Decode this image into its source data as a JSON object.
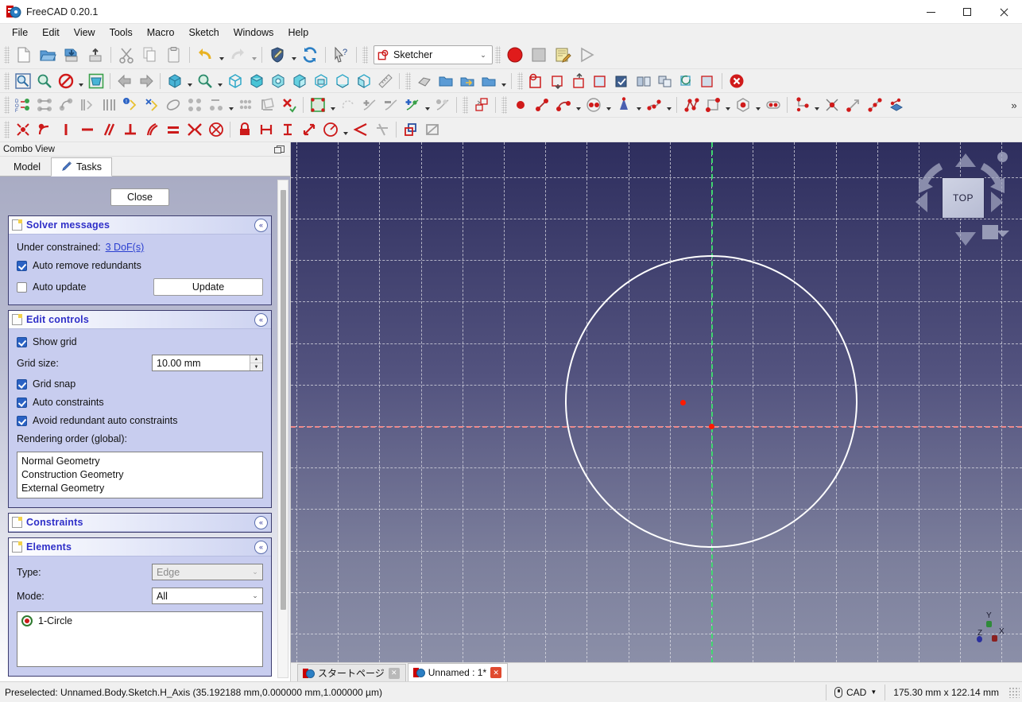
{
  "window": {
    "title": "FreeCAD 0.20.1",
    "logo_icon": "freecad-logo-icon",
    "minimize_label": "─",
    "maximize_label": "□",
    "close_label": "✕"
  },
  "menubar": {
    "items": [
      {
        "label": "File"
      },
      {
        "label": "Edit"
      },
      {
        "label": "View"
      },
      {
        "label": "Tools"
      },
      {
        "label": "Macro"
      },
      {
        "label": "Sketch"
      },
      {
        "label": "Windows"
      },
      {
        "label": "Help"
      }
    ]
  },
  "toolbars": {
    "file": [
      {
        "name": "new-document-button",
        "icon": "new-document-icon"
      },
      {
        "name": "open-document-button",
        "icon": "open-folder-icon"
      },
      {
        "name": "save-document-button",
        "icon": "save-icon"
      },
      {
        "name": "save-as-button",
        "icon": "save-as-icon"
      },
      {
        "name": "cut-button",
        "icon": "scissors-icon"
      },
      {
        "name": "copy-button",
        "icon": "copy-icon"
      },
      {
        "name": "paste-button",
        "icon": "clipboard-paste-icon"
      },
      {
        "name": "undo-button",
        "icon": "undo-arrow-icon"
      },
      {
        "name": "redo-button",
        "icon": "redo-arrow-icon"
      },
      {
        "name": "refresh-style-button",
        "icon": "shield-pencil-icon"
      },
      {
        "name": "refresh-button",
        "icon": "refresh-icon"
      },
      {
        "name": "whats-this-button",
        "icon": "cursor-question-icon"
      }
    ],
    "workbench": {
      "name": "workbench-selector",
      "value": "Sketcher",
      "icon": "sketcher-workbench-icon",
      "caret": "⌄"
    },
    "macro": [
      {
        "name": "macro-record-button",
        "icon": "record-circle-icon"
      },
      {
        "name": "macro-stop-button",
        "icon": "stop-square-icon"
      },
      {
        "name": "macro-edit-button",
        "icon": "notepad-pencil-icon"
      },
      {
        "name": "macro-execute-button",
        "icon": "play-triangle-icon"
      }
    ],
    "view": [
      {
        "name": "fit-all-button",
        "icon": "fit-all-magnifier-icon"
      },
      {
        "name": "fit-selection-button",
        "icon": "fit-selection-magnifier-icon"
      },
      {
        "name": "draw-style-button",
        "icon": "no-entry-draw-style-icon"
      },
      {
        "name": "box-selection-button",
        "icon": "box-selection-icon"
      },
      {
        "name": "nav-back-button",
        "icon": "arrow-left-icon"
      },
      {
        "name": "nav-forward-button",
        "icon": "arrow-right-icon"
      },
      {
        "name": "std-views-button",
        "icon": "cube-views-icon"
      },
      {
        "name": "zoom-button",
        "icon": "zoom-magnifier-icon"
      },
      {
        "name": "isometric-view-button",
        "icon": "isometric-cube-icon"
      },
      {
        "name": "front-view-button",
        "icon": "front-view-cube-icon"
      },
      {
        "name": "top-view-button",
        "icon": "top-view-cube-icon"
      },
      {
        "name": "right-view-button",
        "icon": "right-view-cube-icon"
      },
      {
        "name": "rear-view-button",
        "icon": "rear-view-cube-icon"
      },
      {
        "name": "bottom-view-button",
        "icon": "bottom-view-cube-icon"
      },
      {
        "name": "left-view-button",
        "icon": "left-view-cube-icon"
      },
      {
        "name": "measure-button",
        "icon": "ruler-icon"
      },
      {
        "name": "part-boolean-button",
        "icon": "part-shape-icon"
      },
      {
        "name": "create-group-button",
        "icon": "folder-icon"
      },
      {
        "name": "link-object-button",
        "icon": "link-arrow-icon"
      },
      {
        "name": "link-actions-button",
        "icon": "link-folder-icon"
      },
      {
        "name": "create-sketch-button",
        "icon": "create-sketch-icon"
      },
      {
        "name": "attach-sketch-button",
        "icon": "attach-sketch-icon"
      },
      {
        "name": "detach-sketch-button",
        "icon": "detach-sketch-icon"
      },
      {
        "name": "view-section-button",
        "icon": "view-section-icon"
      },
      {
        "name": "validate-sketch-button",
        "icon": "validate-sketch-icon"
      },
      {
        "name": "mirror-sketch-button",
        "icon": "mirror-sketch-icon"
      },
      {
        "name": "merge-sketch-button",
        "icon": "merge-sketch-icon"
      },
      {
        "name": "reorient-sketch-button",
        "icon": "reorient-sketch-icon"
      },
      {
        "name": "map-sketch-button",
        "icon": "map-sketch-icon"
      },
      {
        "name": "sketch-grid-button",
        "icon": "sketch-grid-icon"
      },
      {
        "name": "leave-sketch-button",
        "icon": "leave-sketch-red-x-icon"
      }
    ],
    "sketcher_visual": [
      {
        "name": "show-dof-button",
        "icon": "dof-counter-icon"
      },
      {
        "name": "select-horiz-edges-button",
        "icon": "select-horizontal-edges-icon"
      },
      {
        "name": "select-vert-edges-button",
        "icon": "select-vertical-edges-icon"
      },
      {
        "name": "select-constraints-button",
        "icon": "select-associated-constraints-icon"
      },
      {
        "name": "select-geometry-button",
        "icon": "select-associated-geometry-icon"
      },
      {
        "name": "select-redundant-button",
        "icon": "select-redundant-constraints-icon"
      },
      {
        "name": "select-conflicting-button",
        "icon": "select-conflicting-constraints-icon"
      },
      {
        "name": "select-elements-circle-button",
        "icon": "select-elements-ellipse-icon"
      },
      {
        "name": "restore-internal-geometry-button",
        "icon": "restore-internal-geometry-icon"
      },
      {
        "name": "symmetry-button",
        "icon": "symmetry-icon"
      },
      {
        "name": "clone-button",
        "icon": "clone-points-icon"
      },
      {
        "name": "rectangular-array-button",
        "icon": "rectangular-array-icon"
      },
      {
        "name": "remove-axes-alignment-button",
        "icon": "remove-axes-alignment-icon"
      },
      {
        "name": "delete-all-constraints-button",
        "icon": "delete-all-constraints-icon"
      },
      {
        "name": "visual-sketch-button",
        "icon": "visual-sketch-green-icon"
      },
      {
        "name": "switch-virtual-space-button",
        "icon": "switch-virtual-space-icon"
      },
      {
        "name": "join-curves-button",
        "icon": "join-curves-icon"
      },
      {
        "name": "trim-edge-button",
        "icon": "trim-edge-icon"
      },
      {
        "name": "extend-edge-button",
        "icon": "extend-edge-icon"
      },
      {
        "name": "split-edge-button",
        "icon": "split-edge-icon"
      },
      {
        "name": "external-geometry-button",
        "icon": "external-geometry-icon"
      },
      {
        "name": "carbon-copy-button",
        "icon": "carbon-copy-icon"
      },
      {
        "name": "create-point-button",
        "icon": "point-icon"
      },
      {
        "name": "create-line-button",
        "icon": "line-icon"
      },
      {
        "name": "create-arc-button",
        "icon": "arc-icon"
      },
      {
        "name": "create-circle-button",
        "icon": "circle-icon"
      },
      {
        "name": "create-conic-button",
        "icon": "conic-icon"
      },
      {
        "name": "create-bspline-button",
        "icon": "bspline-icon"
      },
      {
        "name": "create-polyline-button",
        "icon": "polyline-icon"
      },
      {
        "name": "create-rectangle-button",
        "icon": "rectangle-icon"
      },
      {
        "name": "create-polygon-button",
        "icon": "hexagon-icon"
      },
      {
        "name": "create-slot-button",
        "icon": "slot-icon"
      },
      {
        "name": "create-fillet-button",
        "icon": "fillet-icon"
      },
      {
        "name": "trim-button",
        "icon": "trim-scissor-icon"
      },
      {
        "name": "extend-button",
        "icon": "extend-arrow-icon"
      },
      {
        "name": "split-button",
        "icon": "split-icon"
      },
      {
        "name": "toggle-construction-button",
        "icon": "toggle-construction-geometry-icon"
      }
    ],
    "constraints": [
      {
        "name": "constrain-coincident-button",
        "icon": "constraint-coincident-icon"
      },
      {
        "name": "constrain-point-on-object-button",
        "icon": "constraint-point-on-object-icon"
      },
      {
        "name": "constrain-vertical-button",
        "icon": "constraint-vertical-icon"
      },
      {
        "name": "constrain-horizontal-button",
        "icon": "constraint-horizontal-icon"
      },
      {
        "name": "constrain-parallel-button",
        "icon": "constraint-parallel-icon"
      },
      {
        "name": "constrain-perpendicular-button",
        "icon": "constraint-perpendicular-icon"
      },
      {
        "name": "constrain-tangent-button",
        "icon": "constraint-tangent-icon"
      },
      {
        "name": "constrain-equal-button",
        "icon": "constraint-equal-icon"
      },
      {
        "name": "constrain-symmetric-button",
        "icon": "constraint-symmetric-icon"
      },
      {
        "name": "constrain-block-button",
        "icon": "constraint-block-icon"
      },
      {
        "name": "constrain-lock-button",
        "icon": "constraint-lock-icon"
      },
      {
        "name": "constrain-distance-x-button",
        "icon": "constraint-horizontal-distance-icon"
      },
      {
        "name": "constrain-distance-y-button",
        "icon": "constraint-vertical-distance-icon"
      },
      {
        "name": "constrain-distance-button",
        "icon": "constraint-distance-icon"
      },
      {
        "name": "constrain-radius-button",
        "icon": "constraint-radius-icon"
      },
      {
        "name": "constrain-angle-button",
        "icon": "constraint-angle-icon"
      },
      {
        "name": "constrain-refraction-button",
        "icon": "constraint-snell-law-icon"
      },
      {
        "name": "toggle-driving-constraint-button",
        "icon": "toggle-driving-constraint-icon"
      },
      {
        "name": "activate-deactivate-constraint-button",
        "icon": "activate-deactivate-constraint-icon"
      }
    ],
    "overflow_label": "»"
  },
  "combo_view": {
    "panel_title": "Combo View",
    "float_icon": "undock-panel-icon",
    "tabs": [
      {
        "label": "Model",
        "icon": "model-tree-icon",
        "active": false
      },
      {
        "label": "Tasks",
        "icon": "pencil-icon",
        "active": true
      }
    ]
  },
  "tasks": {
    "close_button": "Close",
    "solver": {
      "title": "Solver messages",
      "under_constrained_label": "Under constrained:",
      "dof_link": "3 DoF(s)",
      "auto_remove_redundants": {
        "label": "Auto remove redundants",
        "checked": true
      },
      "auto_update": {
        "label": "Auto update",
        "checked": false
      },
      "update_button": "Update",
      "collapse_icon": "«"
    },
    "edit_controls": {
      "title": "Edit controls",
      "show_grid": {
        "label": "Show grid",
        "checked": true
      },
      "grid_size_label": "Grid size:",
      "grid_size_value": "10.00 mm",
      "grid_snap": {
        "label": "Grid snap",
        "checked": true
      },
      "auto_constraints": {
        "label": "Auto constraints",
        "checked": true
      },
      "avoid_redundant": {
        "label": "Avoid redundant auto constraints",
        "checked": true
      },
      "rendering_order_label": "Rendering order (global):",
      "rendering_order_items": [
        "Normal Geometry",
        "Construction Geometry",
        "External Geometry"
      ],
      "spin_up": "▲",
      "spin_down": "▼",
      "collapse_icon": "«"
    },
    "constraints_panel": {
      "title": "Constraints",
      "collapse_icon": "«"
    },
    "elements_panel": {
      "title": "Elements",
      "type_label": "Type:",
      "type_value": "Edge",
      "mode_label": "Mode:",
      "mode_value": "All",
      "items": [
        {
          "label": "1-Circle",
          "icon": "circle-element-icon"
        }
      ],
      "caret": "⌄",
      "collapse_icon": "«"
    }
  },
  "viewport": {
    "nav_cube": {
      "face_label": "TOP",
      "up_arrow": "nav-up-arrow-icon",
      "down_arrow": "nav-down-arrow-icon",
      "left_arrow": "nav-left-arrow-icon",
      "right_arrow": "nav-right-arrow-icon",
      "rotate_left": "rotate-left-arc-icon",
      "rotate_right": "rotate-right-arc-icon",
      "home_dot": "nav-home-dot-icon",
      "corner_cube": "nav-corner-cube-icon"
    },
    "axis_cross": {
      "x_label": "X",
      "y_label": "Y",
      "z_label": "Z",
      "x_color": "#8b2020",
      "y_color": "#2f8a3a",
      "z_color": "#2a2f9e"
    },
    "sketch": {
      "circle_color": "#ffffff",
      "point_color": "#ff1a00",
      "h_axis_color": "#f58a8a",
      "v_axis_color": "#3ddd6e",
      "grid_color": "#e1e1e8",
      "bg_top": "#2e2e5e",
      "bg_bottom": "#8b8fa8"
    }
  },
  "document_tabs": [
    {
      "label": "スタートページ",
      "active": false,
      "close_label": "✕"
    },
    {
      "label": "Unnamed : 1*",
      "active": true,
      "close_label": "✕"
    }
  ],
  "statusbar": {
    "message": "Preselected: Unnamed.Body.Sketch.H_Axis (35.192188 mm,0.000000 mm,1.000000 µm)",
    "nav_style": "CAD",
    "nav_caret": "▼",
    "dimensions": "175.30 mm x 122.14 mm",
    "mouse_icon": "mouse-navigation-icon"
  }
}
